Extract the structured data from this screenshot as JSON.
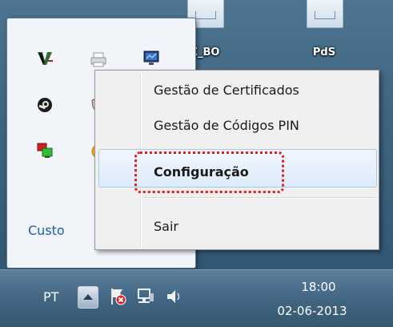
{
  "desktop": {
    "icons": [
      {
        "label": "Z_BO"
      },
      {
        "label": "PdS"
      }
    ]
  },
  "overflow_panel": {
    "icons": [
      "matlab-icon",
      "printer-icon",
      "monitor-icon",
      "steam-icon",
      "shield-icon",
      "network-icon",
      "orange-icon"
    ],
    "customize_label": "Custo"
  },
  "context_menu": {
    "items": [
      {
        "label": "Gestão de Certificados"
      },
      {
        "label": "Gestão de Códigos PIN"
      },
      {
        "label": "Configuração"
      },
      {
        "label": "Sair"
      }
    ],
    "highlighted_item": "Configuração",
    "highlight_color": "#dd1f1f"
  },
  "taskbar": {
    "language": "PT",
    "tray_icons": [
      "show-hidden-icons-button",
      "action-center-error-icon",
      "network-icon",
      "volume-icon"
    ],
    "clock": {
      "time": "18:00",
      "date": "02-06-2013"
    }
  }
}
